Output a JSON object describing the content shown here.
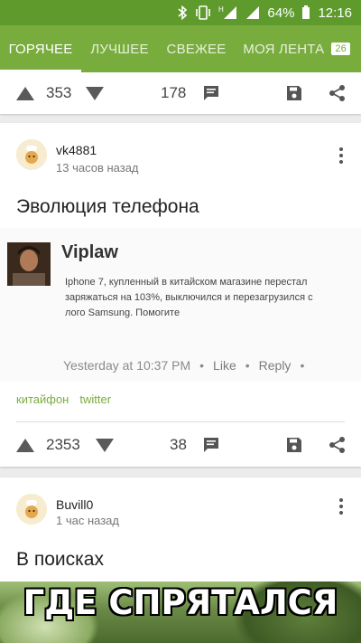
{
  "status_bar": {
    "battery": "64%",
    "time": "12:16",
    "network_letter": "H",
    "icons": [
      "bluetooth-icon",
      "vibrate-icon",
      "signal-icon",
      "battery-icon"
    ]
  },
  "tabs": [
    {
      "label": "ГОРЯЧЕЕ",
      "active": true
    },
    {
      "label": "ЛУЧШЕЕ",
      "active": false
    },
    {
      "label": "СВЕЖЕЕ",
      "active": false
    },
    {
      "label": "МОЯ ЛЕНТА",
      "active": false,
      "badge": "26"
    }
  ],
  "colors": {
    "status_bar": "#5e9a2c",
    "tab_bar": "#78ad3d",
    "tag": "#78ad3d"
  },
  "prev_post": {
    "rating": "353",
    "comments": "178"
  },
  "post1": {
    "author": "vk4881",
    "time": "13 часов назад",
    "title": "Эволюция телефона",
    "screenshot": {
      "name": "Viplaw",
      "text": "Iphone 7, купленный в китайском магазине перестал заряжаться на 103%, выключился и перезагрузился с лого Samsung. Помогите",
      "meta_time": "Yesterday at 10:37 PM",
      "like": "Like",
      "reply": "Reply",
      "dot": "•"
    },
    "tags": [
      "китайфон",
      "twitter"
    ],
    "rating": "2353",
    "comments": "38"
  },
  "post2": {
    "author": "Buvill0",
    "time": "1 час назад",
    "title": "В поисках",
    "meme_text": "ГДЕ СПРЯТАЛСЯ"
  }
}
